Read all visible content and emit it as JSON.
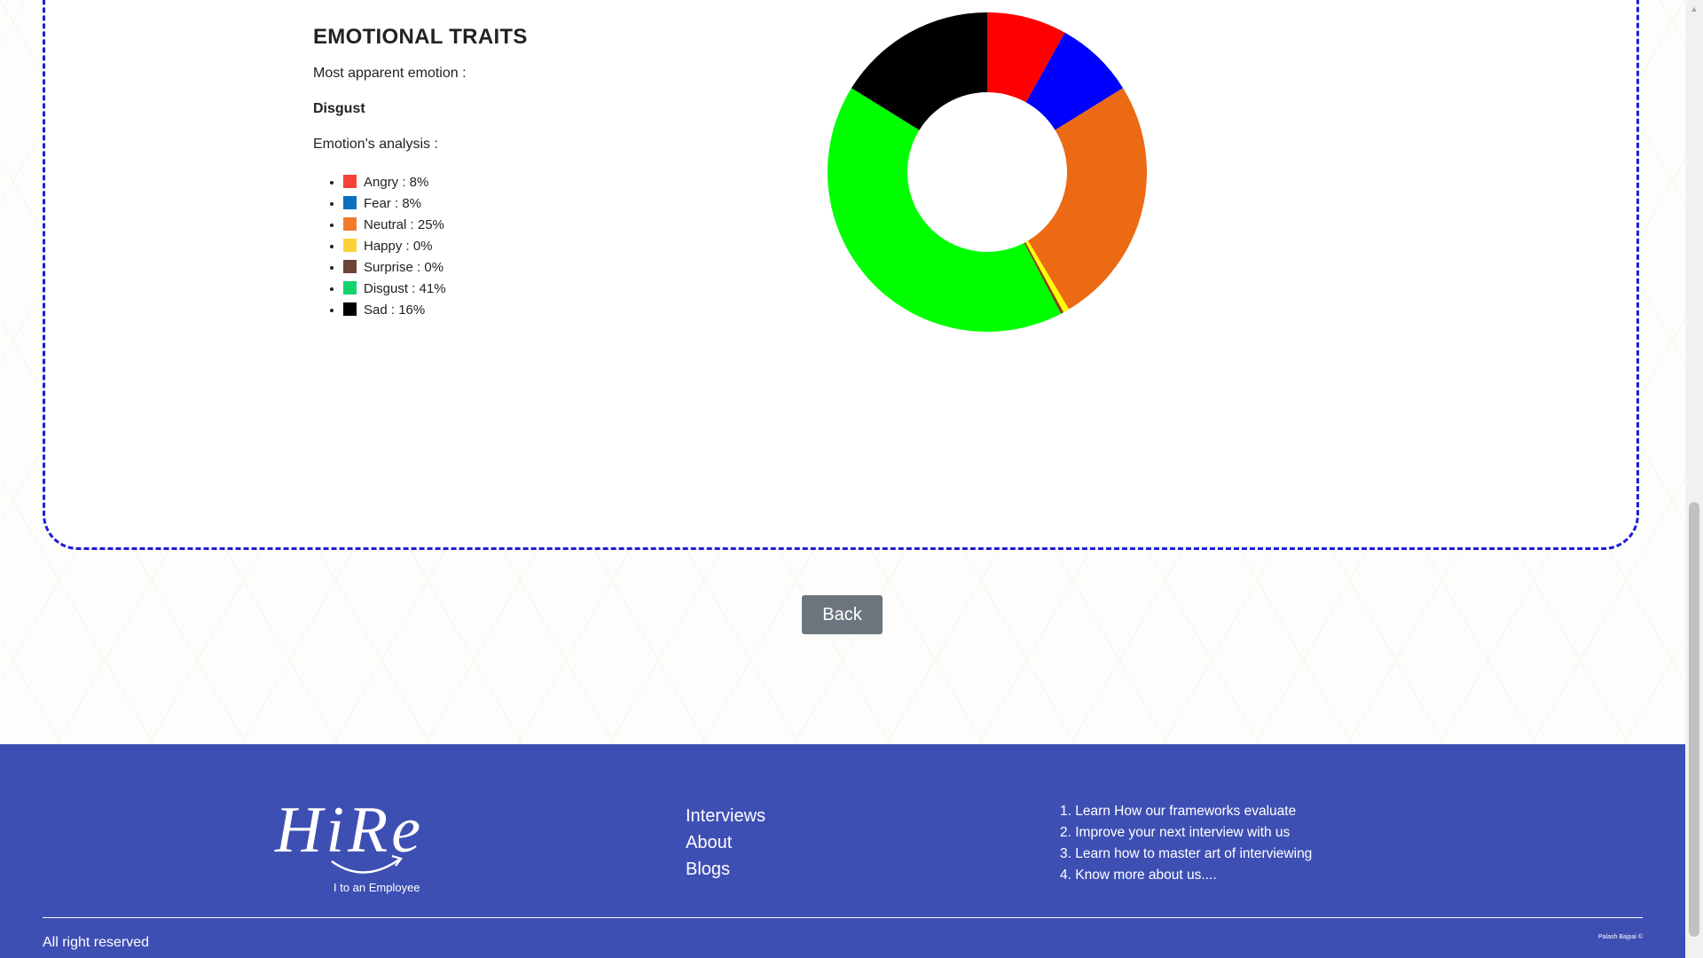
{
  "traits": {
    "title": "EMOTIONAL TRAITS",
    "most_apparent_label": "Most apparent emotion :",
    "most_apparent_value": "Disgust",
    "analysis_label": "Emotion's analysis :",
    "items": [
      {
        "label": "Angry : 8%",
        "color": "#f44336"
      },
      {
        "label": "Fear : 8%",
        "color": "#0e6fbe"
      },
      {
        "label": "Neutral : 25%",
        "color": "#f47a2c"
      },
      {
        "label": "Happy : 0%",
        "color": "#fcd23b"
      },
      {
        "label": "Surprise : 0%",
        "color": "#6b4436"
      },
      {
        "label": "Disgust : 41%",
        "color": "#13d46a"
      },
      {
        "label": "Sad : 16%",
        "color": "#000000"
      }
    ]
  },
  "chart_data": {
    "type": "pie",
    "style": "donut",
    "categories": [
      "Angry",
      "Fear",
      "Neutral",
      "Happy",
      "Surprise",
      "Disgust",
      "Sad"
    ],
    "values": [
      8,
      8,
      25,
      0.6,
      0.3,
      41,
      16
    ],
    "colors": [
      "#ff0000",
      "#0000ff",
      "#ec6a13",
      "#ffff00",
      "#8b4513",
      "#00ff00",
      "#000000"
    ]
  },
  "back_button": {
    "label": "Back"
  },
  "footer": {
    "logo_text": "HiRe",
    "tagline": "I to an Employee",
    "nav": [
      "Interviews",
      "About",
      "Blogs"
    ],
    "links": [
      "1. Learn How our frameworks evaluate",
      "2. Improve your next interview with us",
      "3. Learn how to master art of interviewing",
      "4. Know more about us...."
    ],
    "rights": "All right reserved",
    "credit": "Palash Bajpai ©"
  },
  "scrollbar": {
    "up_arrow": "▲"
  }
}
